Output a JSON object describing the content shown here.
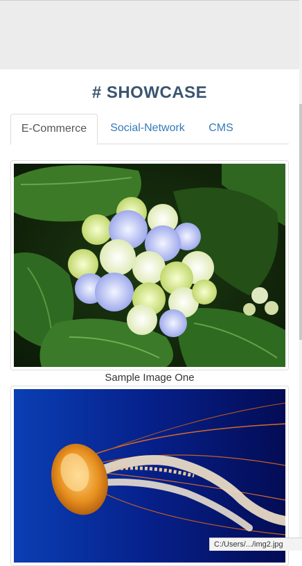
{
  "page": {
    "title": "# SHOWCASE"
  },
  "tabs": [
    {
      "label": "E-Commerce",
      "active": true
    },
    {
      "label": "Social-Network",
      "active": false
    },
    {
      "label": "CMS",
      "active": false
    }
  ],
  "gallery": [
    {
      "caption": "Sample Image One",
      "subject": "blue-white hydrangea flower among green leaves"
    },
    {
      "caption": "",
      "subject": "orange jellyfish on deep blue background"
    }
  ],
  "status_bar": {
    "url": "C:/Users/.../img2.jpg"
  },
  "colors": {
    "title": "#3a5570",
    "link": "#337ab7",
    "active_tab_text": "#555555",
    "header_band": "#ececec"
  }
}
